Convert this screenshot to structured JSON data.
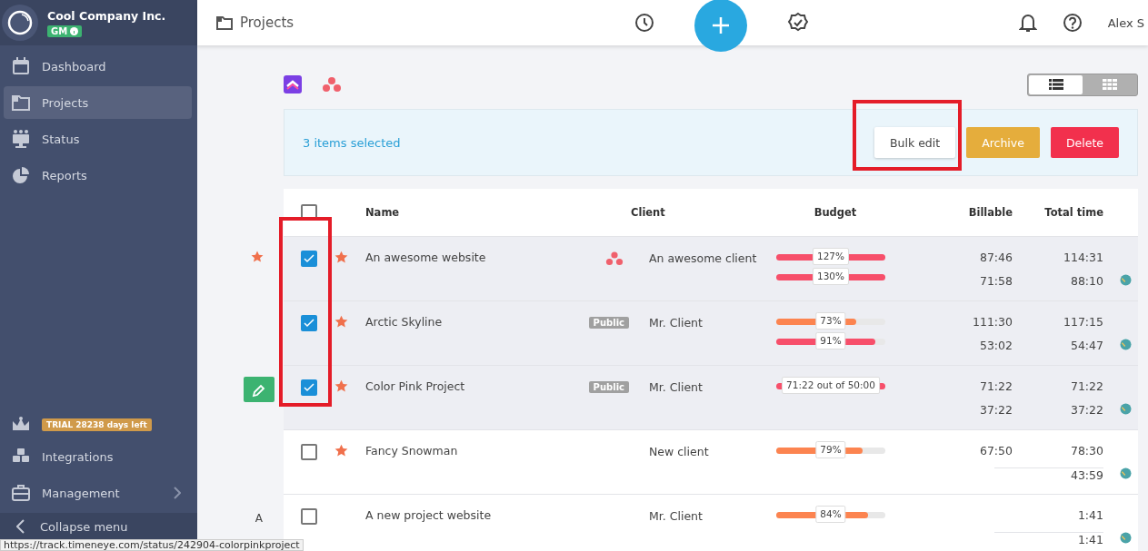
{
  "sidebar": {
    "company": "Cool Company Inc.",
    "badge": "GM",
    "items": [
      {
        "label": "Dashboard",
        "kind": "calendar",
        "selected": false
      },
      {
        "label": "Projects",
        "kind": "folder",
        "selected": true
      },
      {
        "label": "Status",
        "kind": "status",
        "selected": false
      },
      {
        "label": "Reports",
        "kind": "pie",
        "selected": false
      }
    ],
    "trial": "TRIAL 28238 days left",
    "bottom_items": [
      {
        "label": "Integrations",
        "kind": "cubes",
        "submenu": false
      },
      {
        "label": "Management",
        "kind": "briefcase",
        "submenu": true
      }
    ],
    "collapse": "Collapse menu"
  },
  "header": {
    "title": "Projects",
    "user": "Alex S"
  },
  "view_toggle": [
    {
      "kind": "list",
      "selected": true
    },
    {
      "kind": "grid",
      "selected": false
    }
  ],
  "bulk_bar": {
    "text": "3 items selected",
    "buttons": [
      {
        "label": "Bulk edit",
        "kind": "default",
        "highlighted": true
      },
      {
        "label": "Archive",
        "kind": "warning",
        "highlighted": false
      },
      {
        "label": "Delete",
        "kind": "danger",
        "highlighted": false
      }
    ]
  },
  "table": {
    "columns": [
      "Name",
      "Client",
      "Budget",
      "Billable",
      "Total time"
    ],
    "checkbox_column_highlighted": true,
    "select_all_checked": false,
    "rows": [
      {
        "side": {
          "kind": "star"
        },
        "checked": true,
        "starred": true,
        "name": "An awesome website",
        "tag": {
          "kind": "asana"
        },
        "client": "An awesome client",
        "budgets": [
          {
            "label": "127%",
            "level": 1,
            "color": "#f74f6a"
          },
          {
            "label": "130%",
            "level": 1,
            "color": "#f74f6a"
          }
        ],
        "billable": [
          "87:46",
          "71:58"
        ],
        "total": [
          "114:31",
          "88:10"
        ],
        "total_divider": false
      },
      {
        "side": {
          "kind": "none"
        },
        "checked": true,
        "starred": true,
        "name": "Arctic Skyline",
        "tag": {
          "kind": "public",
          "label": "Public"
        },
        "client": "Mr. Client",
        "budgets": [
          {
            "label": "73%",
            "level": 0.73,
            "color": "#fc8450"
          },
          {
            "label": "91%",
            "level": 0.91,
            "color": "#f74f6a"
          }
        ],
        "billable": [
          "111:30",
          "53:02"
        ],
        "total": [
          "117:15",
          "54:47"
        ],
        "total_divider": false
      },
      {
        "side": {
          "kind": "edit"
        },
        "checked": true,
        "starred": true,
        "name": "Color Pink Project",
        "tag": {
          "kind": "public",
          "label": "Public"
        },
        "client": "Mr. Client",
        "budgets": [
          {
            "label": "71:22 out of 50:00",
            "level": 1,
            "color": "#f74f6a"
          }
        ],
        "billable": [
          "71:22",
          "37:22"
        ],
        "total": [
          "71:22",
          "37:22"
        ],
        "total_divider": false
      },
      {
        "side": {
          "kind": "none"
        },
        "checked": false,
        "starred": true,
        "name": "Fancy Snowman",
        "client": "New client",
        "budgets": [
          {
            "label": "79%",
            "level": 0.79,
            "color": "#fc8450"
          }
        ],
        "billable": [
          "67:50"
        ],
        "total": [
          "78:30",
          "43:59"
        ],
        "total_divider": true
      },
      {
        "side": {
          "kind": "letter",
          "label": "A"
        },
        "checked": false,
        "starred": false,
        "name": "A new project website",
        "client": "Mr. Client",
        "budgets": [
          {
            "label": "84%",
            "level": 0.84,
            "color": "#fc8450"
          }
        ],
        "billable": [],
        "total": [
          "1:41",
          "1:41"
        ],
        "total_divider": true
      }
    ]
  },
  "status_url": "https://track.timeneye.com/status/242904-colorpinkproject"
}
